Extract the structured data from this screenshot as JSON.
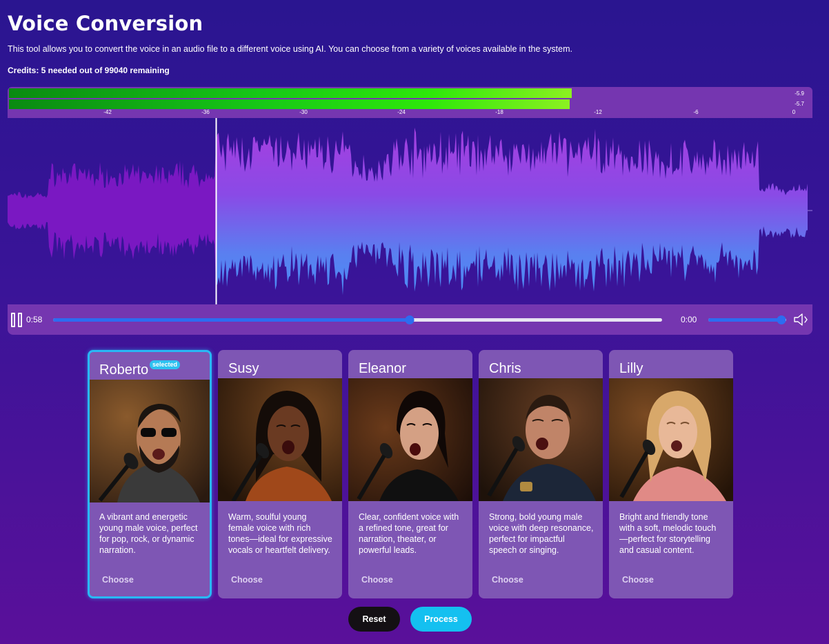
{
  "page": {
    "title": "Voice Conversion",
    "description": "This tool allows you to convert the voice in an audio file to a different voice using AI. You can choose from a variety of voices available in the system.",
    "credits": "Credits: 5 needed out of 99040 remaining"
  },
  "meter": {
    "levels_db": [
      -5.9,
      -5.7
    ],
    "peak_labels": [
      "-5.9",
      "-5.7"
    ],
    "ticks": [
      "-42",
      "-36",
      "-30",
      "-24",
      "-18",
      "-12",
      "-6",
      "0"
    ]
  },
  "player": {
    "current_time": "0:58",
    "remaining_time": "0:00",
    "progress": 0.585,
    "playhead": 0.26,
    "volume": 0.94,
    "pause_icon": "pause-icon",
    "volume_icon": "speaker-icon"
  },
  "voices": [
    {
      "name": "Roberto",
      "badge": "selected",
      "description": "A vibrant and energetic young male voice, perfect for pop, rock, or dynamic narration.",
      "choose_label": "Choose"
    },
    {
      "name": "Susy",
      "description": "Warm, soulful young female voice with rich tones—ideal for expressive vocals or heartfelt delivery.",
      "choose_label": "Choose"
    },
    {
      "name": "Eleanor",
      "description": "Clear, confident voice with a refined tone, great for narration, theater, or powerful leads.",
      "choose_label": "Choose"
    },
    {
      "name": "Chris",
      "description": "Strong, bold young male voice with deep resonance, perfect for impactful speech or singing.",
      "choose_label": "Choose"
    },
    {
      "name": "Lilly",
      "description": "Bright and friendly tone with a soft, melodic touch—perfect for storytelling and casual content.",
      "choose_label": "Choose"
    }
  ],
  "actions": {
    "reset_label": "Reset",
    "process_label": "Process"
  },
  "colors": {
    "accent": "#29b8f5",
    "player_blue": "#2d6cf0",
    "card_bg": "#7e56b4",
    "played_wave": "#7a18c2",
    "unplayed_wave_top": "#9b3de0",
    "unplayed_wave_bottom": "#4a8ef5"
  }
}
